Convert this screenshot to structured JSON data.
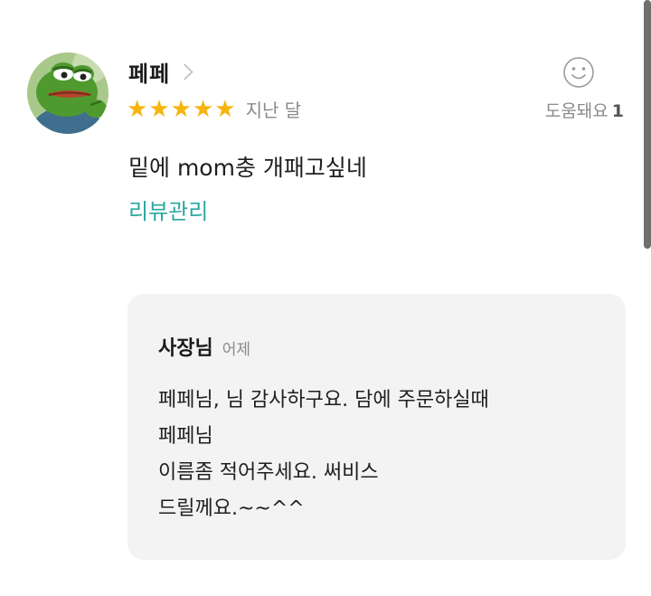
{
  "review": {
    "author": "페페",
    "rating": 5,
    "date": "지난 달",
    "helpful_label": "도움돼요",
    "helpful_count": "1",
    "text": "밑에 mom충 개패고싶네",
    "manage_link": "리뷰관리",
    "avatar_icon": "frog-avatar-icon",
    "star_color": "#f6b40e"
  },
  "reply": {
    "author": "사장님",
    "date": "어제",
    "lines": [
      "페페님, 님 감사하구요. 담에  주문하실때",
      "페페님",
      "이름좀 적어주세요. 써비스",
      "드릴께요.~~^^"
    ]
  },
  "colors": {
    "link": "#2aa8a0",
    "muted": "#8a8a8a",
    "reply_bg": "#f3f3f3"
  }
}
